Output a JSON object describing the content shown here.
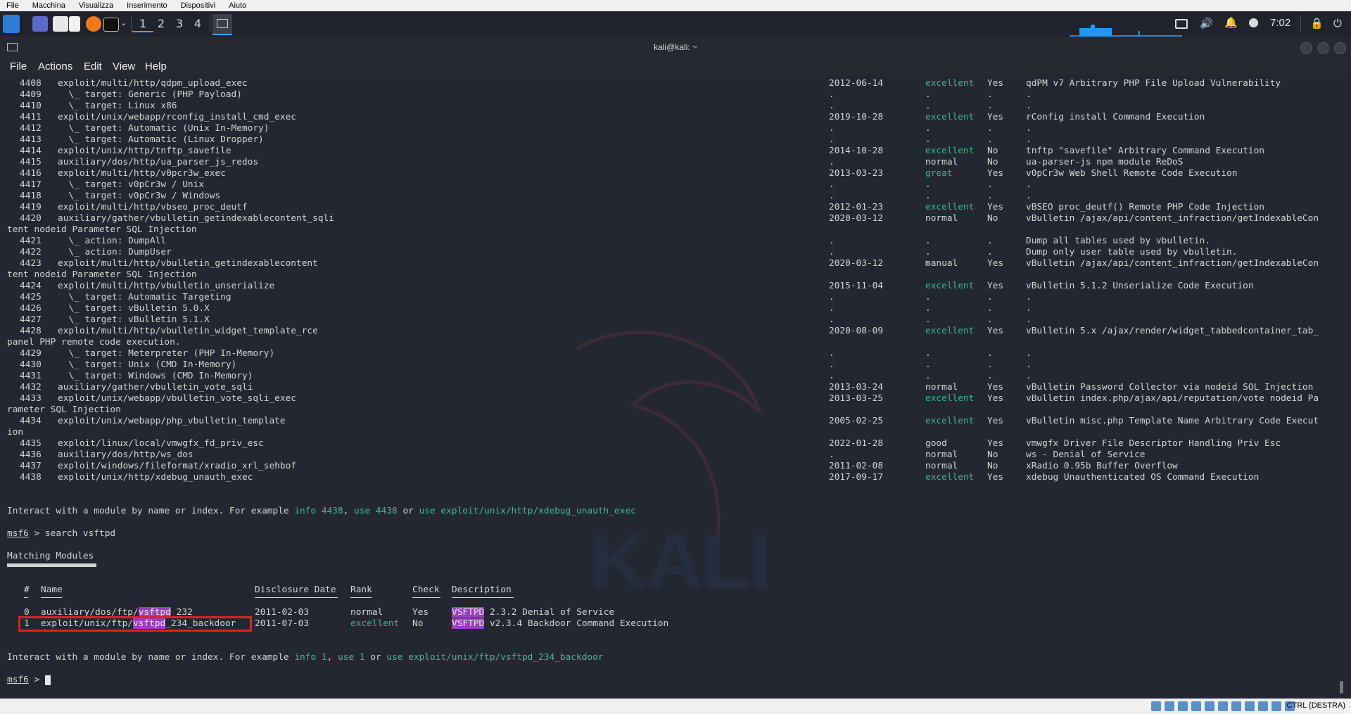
{
  "vbox_menu": [
    "File",
    "Macchina",
    "Visualizza",
    "Inserimento",
    "Dispositivi",
    "Aiuto"
  ],
  "panel": {
    "workspaces": [
      "1",
      "2",
      "3",
      "4"
    ],
    "clock": "7:02"
  },
  "window": {
    "title": "kali@kali: ~"
  },
  "term_menu": [
    "File",
    "Actions",
    "Edit",
    "View",
    "Help"
  ],
  "rows": [
    {
      "n": "4408",
      "name": "exploit/multi/http/qdpm_upload_exec",
      "date": "2012-06-14",
      "rank": "excellent",
      "check": "Yes",
      "desc": "qdPM v7 Arbitrary PHP File Upload Vulnerability"
    },
    {
      "n": "4409",
      "name": "  \\_ target: Generic (PHP Payload)",
      "date": ".",
      "rank": ".",
      "check": ".",
      "desc": "."
    },
    {
      "n": "4410",
      "name": "  \\_ target: Linux x86",
      "date": ".",
      "rank": ".",
      "check": ".",
      "desc": "."
    },
    {
      "n": "4411",
      "name": "exploit/unix/webapp/rconfig_install_cmd_exec",
      "date": "2019-10-28",
      "rank": "excellent",
      "check": "Yes",
      "desc": "rConfig install Command Execution"
    },
    {
      "n": "4412",
      "name": "  \\_ target: Automatic (Unix In-Memory)",
      "date": ".",
      "rank": ".",
      "check": ".",
      "desc": "."
    },
    {
      "n": "4413",
      "name": "  \\_ target: Automatic (Linux Dropper)",
      "date": ".",
      "rank": ".",
      "check": ".",
      "desc": "."
    },
    {
      "n": "4414",
      "name": "exploit/unix/http/tnftp_savefile",
      "date": "2014-10-28",
      "rank": "excellent",
      "check": "No",
      "desc": "tnftp \"savefile\" Arbitrary Command Execution"
    },
    {
      "n": "4415",
      "name": "auxiliary/dos/http/ua_parser_js_redos",
      "date": ".",
      "rank": "normal",
      "check": "No",
      "desc": "ua-parser-js npm module ReDoS"
    },
    {
      "n": "4416",
      "name": "exploit/multi/http/v0pcr3w_exec",
      "date": "2013-03-23",
      "rank": "great",
      "check": "Yes",
      "desc": "v0pCr3w Web Shell Remote Code Execution"
    },
    {
      "n": "4417",
      "name": "  \\_ target: v0pCr3w / Unix",
      "date": ".",
      "rank": ".",
      "check": ".",
      "desc": "."
    },
    {
      "n": "4418",
      "name": "  \\_ target: v0pCr3w / Windows",
      "date": ".",
      "rank": ".",
      "check": ".",
      "desc": "."
    },
    {
      "n": "4419",
      "name": "exploit/multi/http/vbseo_proc_deutf",
      "date": "2012-01-23",
      "rank": "excellent",
      "check": "Yes",
      "desc": "vBSEO proc_deutf() Remote PHP Code Injection"
    },
    {
      "n": "4420",
      "name": "auxiliary/gather/vbulletin_getindexablecontent_sqli",
      "date": "2020-03-12",
      "rank": "normal",
      "check": "No",
      "desc": "vBulletin /ajax/api/content_infraction/getIndexableCon",
      "wrap": "tent nodeid Parameter SQL Injection"
    },
    {
      "n": "4421",
      "name": "  \\_ action: DumpAll",
      "date": ".",
      "rank": ".",
      "check": ".",
      "desc": "Dump all tables used by vbulletin."
    },
    {
      "n": "4422",
      "name": "  \\_ action: DumpUser",
      "date": ".",
      "rank": ".",
      "check": ".",
      "desc": "Dump only user table used by vbulletin."
    },
    {
      "n": "4423",
      "name": "exploit/multi/http/vbulletin_getindexablecontent",
      "date": "2020-03-12",
      "rank": "manual",
      "check": "Yes",
      "desc": "vBulletin /ajax/api/content_infraction/getIndexableCon",
      "wrap": "tent nodeid Parameter SQL Injection"
    },
    {
      "n": "4424",
      "name": "exploit/multi/http/vbulletin_unserialize",
      "date": "2015-11-04",
      "rank": "excellent",
      "check": "Yes",
      "desc": "vBulletin 5.1.2 Unserialize Code Execution"
    },
    {
      "n": "4425",
      "name": "  \\_ target: Automatic Targeting",
      "date": ".",
      "rank": ".",
      "check": ".",
      "desc": "."
    },
    {
      "n": "4426",
      "name": "  \\_ target: vBulletin 5.0.X",
      "date": ".",
      "rank": ".",
      "check": ".",
      "desc": "."
    },
    {
      "n": "4427",
      "name": "  \\_ target: vBulletin 5.1.X",
      "date": ".",
      "rank": ".",
      "check": ".",
      "desc": "."
    },
    {
      "n": "4428",
      "name": "exploit/multi/http/vbulletin_widget_template_rce",
      "date": "2020-08-09",
      "rank": "excellent",
      "check": "Yes",
      "desc": "vBulletin 5.x /ajax/render/widget_tabbedcontainer_tab_",
      "wrap": "panel PHP remote code execution."
    },
    {
      "n": "4429",
      "name": "  \\_ target: Meterpreter (PHP In-Memory)",
      "date": ".",
      "rank": ".",
      "check": ".",
      "desc": "."
    },
    {
      "n": "4430",
      "name": "  \\_ target: Unix (CMD In-Memory)",
      "date": ".",
      "rank": ".",
      "check": ".",
      "desc": "."
    },
    {
      "n": "4431",
      "name": "  \\_ target: Windows (CMD In-Memory)",
      "date": ".",
      "rank": ".",
      "check": ".",
      "desc": "."
    },
    {
      "n": "4432",
      "name": "auxiliary/gather/vbulletin_vote_sqli",
      "date": "2013-03-24",
      "rank": "normal",
      "check": "Yes",
      "desc": "vBulletin Password Collector via nodeid SQL Injection"
    },
    {
      "n": "4433",
      "name": "exploit/unix/webapp/vbulletin_vote_sqli_exec",
      "date": "2013-03-25",
      "rank": "excellent",
      "check": "Yes",
      "desc": "vBulletin index.php/ajax/api/reputation/vote nodeid Pa",
      "wrap": "rameter SQL Injection"
    },
    {
      "n": "4434",
      "name": "exploit/unix/webapp/php_vbulletin_template",
      "date": "2005-02-25",
      "rank": "excellent",
      "check": "Yes",
      "desc": "vBulletin misc.php Template Name Arbitrary Code Execut",
      "wrap": "ion"
    },
    {
      "n": "4435",
      "name": "exploit/linux/local/vmwgfx_fd_priv_esc",
      "date": "2022-01-28",
      "rank": "good",
      "check": "Yes",
      "desc": "vmwgfx Driver File Descriptor Handling Priv Esc"
    },
    {
      "n": "4436",
      "name": "auxiliary/dos/http/ws_dos",
      "date": ".",
      "rank": "normal",
      "check": "No",
      "desc": "ws - Denial of Service"
    },
    {
      "n": "4437",
      "name": "exploit/windows/fileformat/xradio_xrl_sehbof",
      "date": "2011-02-08",
      "rank": "normal",
      "check": "No",
      "desc": "xRadio 0.95b Buffer Overflow"
    },
    {
      "n": "4438",
      "name": "exploit/unix/http/xdebug_unauth_exec",
      "date": "2017-09-17",
      "rank": "excellent",
      "check": "Yes",
      "desc": "xdebug Unauthenticated OS Command Execution"
    }
  ],
  "interact1": {
    "pre": "Interact with a module by name or index. For example ",
    "a": "info 4438",
    ",": ", ",
    "b": "use 4438",
    "or": " or ",
    "c": "use exploit/unix/http/xdebug_unauth_exec"
  },
  "prompt": "msf6",
  "prompt_sep": " > ",
  "cmd": "search vsftpd",
  "matching": "Matching Modules",
  "headers": {
    "n": "#",
    "name": "Name",
    "date": "Disclosure Date",
    "rank": "Rank",
    "check": "Check",
    "desc": "Description"
  },
  "results": [
    {
      "n": "0",
      "pre": "auxiliary/dos/ftp/",
      "hl": "vsftpd",
      "post": "_232",
      "date": "2011-02-03",
      "rank": "normal",
      "check": "Yes",
      "dhl": "VSFTPD",
      "dpost": " 2.3.2 Denial of Service"
    },
    {
      "n": "1",
      "pre": "exploit/unix/ftp/",
      "hl": "vsftpd",
      "post": "_234_backdoor",
      "date": "2011-07-03",
      "rank": "excellent",
      "check": "No",
      "dhl": "VSFTPD",
      "dpost": " v2.3.4 Backdoor Command Execution"
    }
  ],
  "interact2": {
    "pre": "Interact with a module by name or index. For example ",
    "a": "info 1",
    ",": ", ",
    "b": "use 1",
    "or": " or ",
    "c": "use exploit/unix/ftp/vsftpd_234_backdoor"
  },
  "status": {
    "hostkey": "CTRL (DESTRA)"
  }
}
